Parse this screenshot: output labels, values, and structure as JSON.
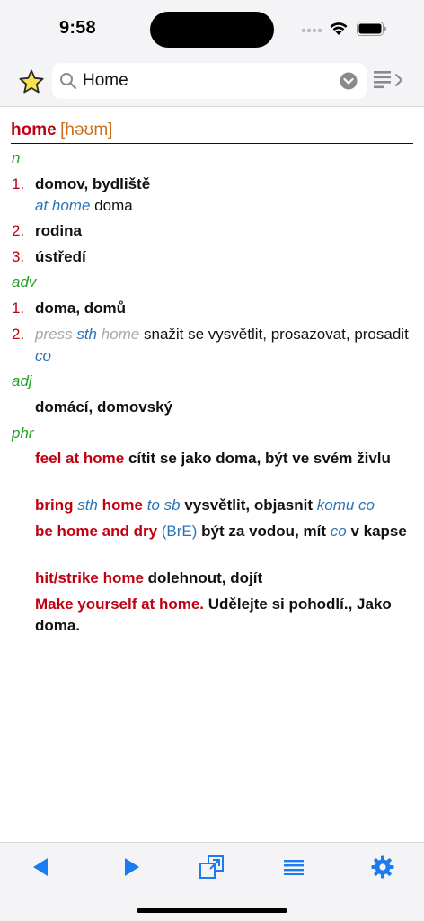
{
  "status_bar": {
    "time": "9:58"
  },
  "search": {
    "value": "Home"
  },
  "entry": {
    "headword": "home",
    "pronunciation": "[həʊm]",
    "noun": {
      "pos": "n",
      "senses": [
        {
          "num": "1.",
          "text": "domov, bydliště",
          "example_en": "at home",
          "example_cs": "doma"
        },
        {
          "num": "2.",
          "text": "rodina"
        },
        {
          "num": "3.",
          "text": "ústředí"
        }
      ]
    },
    "adverb": {
      "pos": "adv",
      "senses": [
        {
          "num": "1.",
          "text": "doma, domů"
        },
        {
          "num": "2.",
          "press": "press",
          "sth": "sth",
          "home": "home",
          "text": "snažit se vysvětlit, prosazovat, prosadit",
          "abbr": "co"
        }
      ]
    },
    "adjective": {
      "pos": "adj",
      "text": "domácí, domovský"
    },
    "phrases": {
      "pos": "phr",
      "items": [
        {
          "phrase": "feel at home",
          "translation": "cítit se jako doma, být ve svém živlu"
        },
        {
          "phrase_a": "bring",
          "sth": "sth",
          "phrase_b": "home",
          "sb": "to sb",
          "translation": "vysvětlit, objasnit",
          "note": "komu co"
        },
        {
          "phrase": "be home and dry",
          "region": "(BrE)",
          "translation_a": "být za vodou, mít",
          "abbr": "co",
          "translation_b": "v kapse"
        },
        {
          "phrase": "hit/strike home",
          "translation": "dolehnout, dojít"
        },
        {
          "phrase": "Make yourself at home.",
          "translation": "Udělejte si pohodlí., Jako doma."
        }
      ]
    }
  },
  "colors": {
    "headword": "#c00010",
    "pronunciation": "#c87020",
    "pos": "#1ea020",
    "example": "#2a74b8",
    "accent": "#1a7cf0"
  }
}
